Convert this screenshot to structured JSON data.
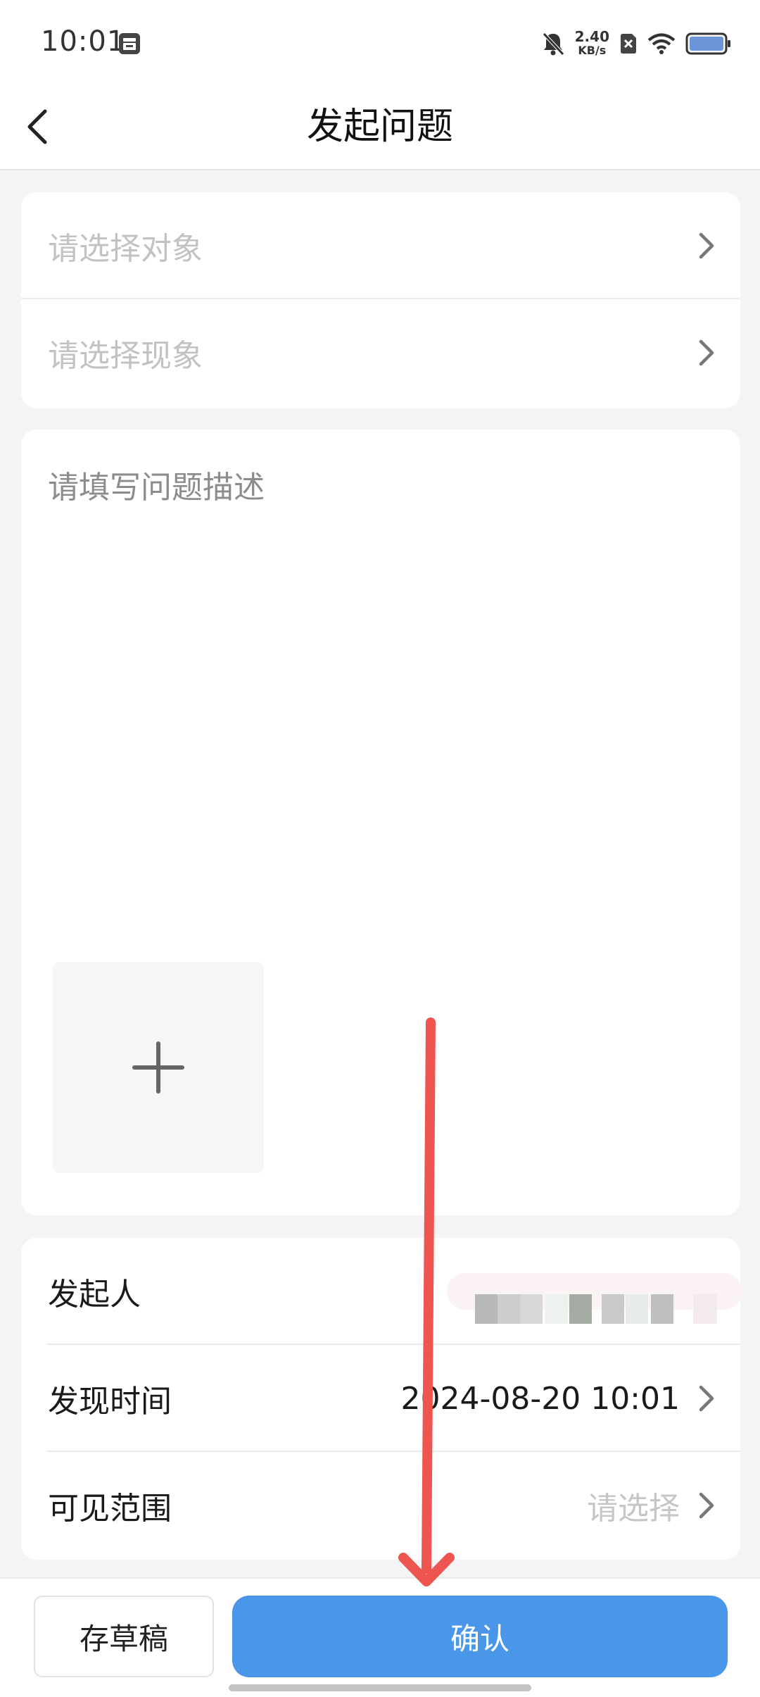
{
  "status_bar": {
    "time": "10:01",
    "net_speed_value": "2.40",
    "net_speed_unit": "KB/s",
    "icons": [
      "notification-icon",
      "mute-bell-icon",
      "no-sim-icon",
      "wifi-icon",
      "battery-icon"
    ]
  },
  "header": {
    "title": "发起问题",
    "back_icon": "chevron-left-icon"
  },
  "selectors": [
    {
      "placeholder": "请选择对象"
    },
    {
      "placeholder": "请选择现象"
    }
  ],
  "description": {
    "placeholder": "请填写问题描述",
    "add_photo_icon": "plus-icon"
  },
  "info": {
    "initiator_label": "发起人",
    "discover_time_label": "发现时间",
    "discover_time_value": "2024-08-20 10:01",
    "visibility_label": "可见范围",
    "visibility_placeholder": "请选择"
  },
  "actions": {
    "draft_label": "存草稿",
    "confirm_label": "确认"
  },
  "colors": {
    "accent": "#4a97ea",
    "annotation_arrow": "#ee5450"
  }
}
